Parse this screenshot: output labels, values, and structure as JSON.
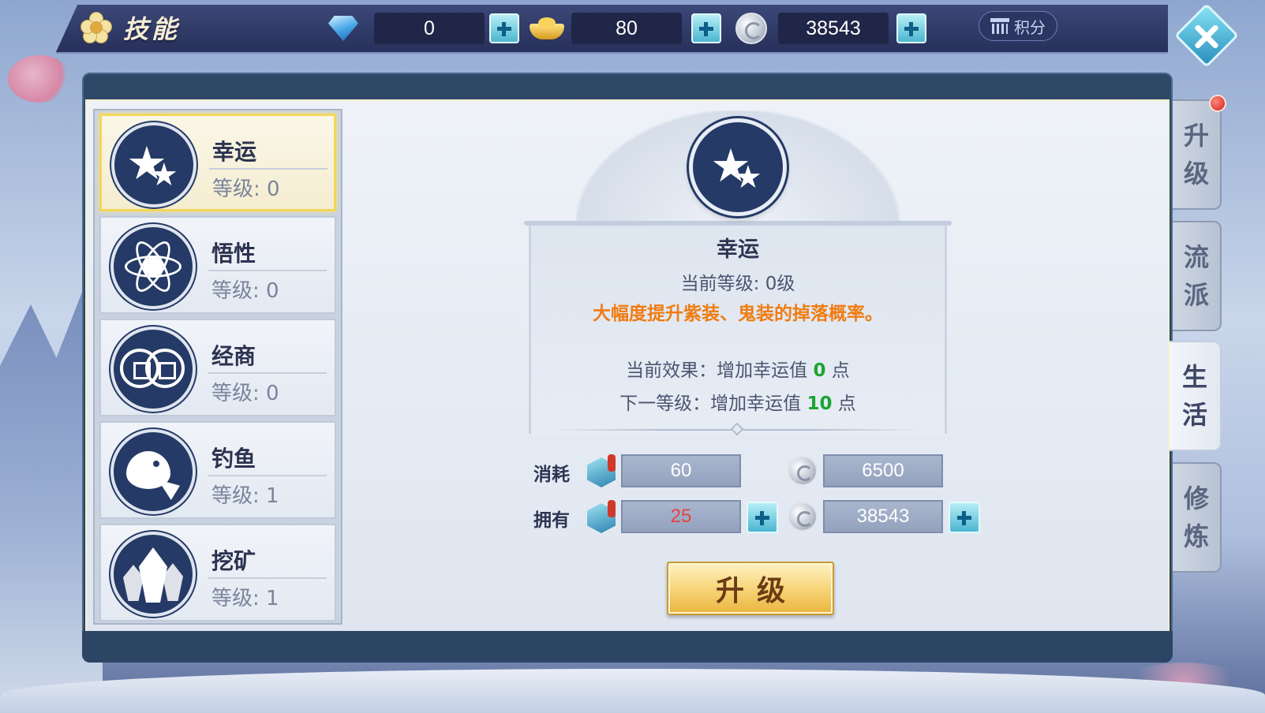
{
  "header": {
    "title": "技能",
    "score_label": "积分",
    "resources": [
      {
        "icon": "diamond-icon",
        "value": "0"
      },
      {
        "icon": "gold-ingot-icon",
        "value": "80"
      },
      {
        "icon": "silver-coin-icon",
        "value": "38543"
      }
    ]
  },
  "skills": [
    {
      "name": "幸运",
      "level": "等级: 0",
      "icon": "star-icon",
      "selected": true
    },
    {
      "name": "悟性",
      "level": "等级: 0",
      "icon": "atom-icon",
      "selected": false
    },
    {
      "name": "经商",
      "level": "等级: 0",
      "icon": "coins-icon",
      "selected": false
    },
    {
      "name": "钓鱼",
      "level": "等级: 1",
      "icon": "fish-icon",
      "selected": false
    },
    {
      "name": "挖矿",
      "level": "等级: 1",
      "icon": "crystal-icon",
      "selected": false
    }
  ],
  "detail": {
    "name": "幸运",
    "current_level": "当前等级: 0级",
    "description": "大幅度提升紫装、鬼装的掉落概率。",
    "current_effect_prefix": "当前效果：增加幸运值 ",
    "current_effect_value": "0",
    "current_effect_suffix": " 点",
    "next_level_prefix": "下一等级：增加幸运值 ",
    "next_level_value": "10",
    "next_level_suffix": " 点",
    "cost_label": "消耗",
    "own_label": "拥有",
    "cost_token": "60",
    "cost_silver": "6500",
    "own_token": "25",
    "own_silver": "38543",
    "upgrade_label": "升级"
  },
  "side_tabs": [
    {
      "label": [
        "升",
        "级"
      ],
      "active": false
    },
    {
      "label": [
        "流",
        "派"
      ],
      "active": false
    },
    {
      "label": [
        "生",
        "活"
      ],
      "active": true
    },
    {
      "label": [
        "修",
        "炼"
      ],
      "active": false
    }
  ],
  "colors": {
    "highlight_text": "#f07c12",
    "positive_value": "#1aa531",
    "insufficient_value": "#e74343",
    "panel_dark": "#253a66"
  }
}
